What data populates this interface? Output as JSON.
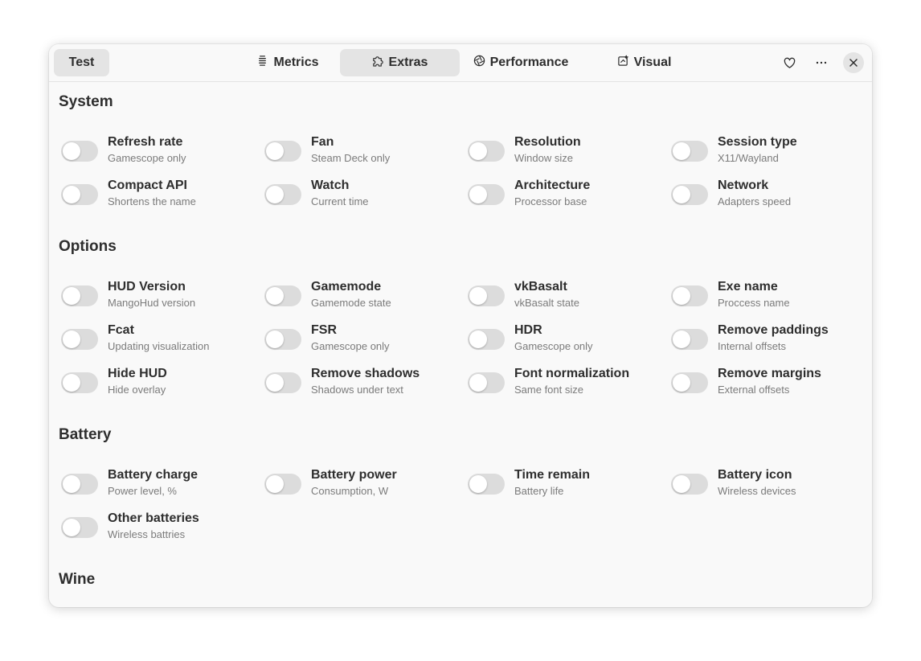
{
  "header": {
    "test_label": "Test",
    "tabs": [
      {
        "label": "Metrics",
        "icon": "metrics-icon"
      },
      {
        "label": "Extras",
        "icon": "puzzle-icon"
      },
      {
        "label": "Performance",
        "icon": "aperture-icon"
      },
      {
        "label": "Visual",
        "icon": "visual-icon"
      }
    ],
    "active_tab": "Extras"
  },
  "sections": {
    "system": {
      "title": "System",
      "items": [
        {
          "label": "Refresh rate",
          "sub": "Gamescope only",
          "enabled": false
        },
        {
          "label": "Fan",
          "sub": "Steam Deck only",
          "enabled": false
        },
        {
          "label": "Resolution",
          "sub": "Window size",
          "enabled": false
        },
        {
          "label": "Session type",
          "sub": "X11/Wayland",
          "enabled": false
        },
        {
          "label": "Compact API",
          "sub": "Shortens the name",
          "enabled": false
        },
        {
          "label": "Watch",
          "sub": "Current time",
          "enabled": false
        },
        {
          "label": "Architecture",
          "sub": "Processor base",
          "enabled": false
        },
        {
          "label": "Network",
          "sub": "Adapters speed",
          "enabled": false
        }
      ]
    },
    "options": {
      "title": "Options",
      "items": [
        {
          "label": "HUD Version",
          "sub": "MangoHud version",
          "enabled": false
        },
        {
          "label": "Gamemode",
          "sub": "Gamemode state",
          "enabled": false
        },
        {
          "label": "vkBasalt",
          "sub": "vkBasalt state",
          "enabled": false
        },
        {
          "label": "Exe name",
          "sub": "Proccess name",
          "enabled": false
        },
        {
          "label": "Fcat",
          "sub": "Updating visualization",
          "enabled": false
        },
        {
          "label": "FSR",
          "sub": "Gamescope only",
          "enabled": false
        },
        {
          "label": "HDR",
          "sub": "Gamescope only",
          "enabled": false
        },
        {
          "label": "Remove paddings",
          "sub": "Internal offsets",
          "enabled": false
        },
        {
          "label": "Hide HUD",
          "sub": "Hide overlay",
          "enabled": false
        },
        {
          "label": "Remove shadows",
          "sub": "Shadows under text",
          "enabled": false
        },
        {
          "label": "Font normalization",
          "sub": "Same font size",
          "enabled": false
        },
        {
          "label": "Remove margins",
          "sub": "External offsets",
          "enabled": false
        }
      ]
    },
    "battery": {
      "title": "Battery",
      "items": [
        {
          "label": "Battery charge",
          "sub": "Power level, %",
          "enabled": false
        },
        {
          "label": "Battery power",
          "sub": "Consumption, W",
          "enabled": false
        },
        {
          "label": "Time remain",
          "sub": "Battery life",
          "enabled": false
        },
        {
          "label": "Battery icon",
          "sub": "Wireless devices",
          "enabled": false
        },
        {
          "label": "Other batteries",
          "sub": "Wireless battries",
          "enabled": false
        }
      ]
    },
    "wine": {
      "title": "Wine"
    }
  }
}
